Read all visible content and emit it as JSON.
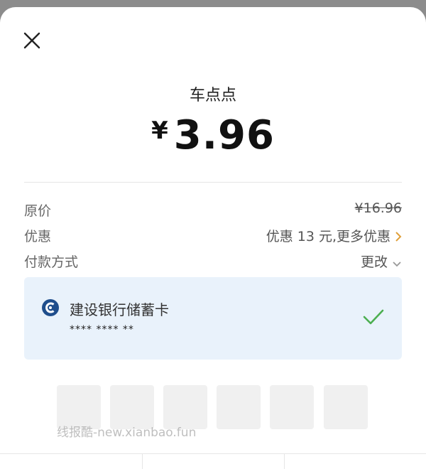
{
  "header": {
    "close_icon": "close-icon",
    "merchant": "车点点",
    "currency": "¥",
    "amount": "3.96"
  },
  "details": {
    "original": {
      "label": "原价",
      "value": "¥16.96"
    },
    "discount": {
      "label": "优惠",
      "value": "优惠 13 元,更多优惠"
    },
    "payment": {
      "label": "付款方式",
      "value": "更改"
    }
  },
  "card": {
    "bank_name": "建设银行储蓄卡",
    "number": "**** **** **",
    "selected": true
  },
  "pin": {
    "digits_entered": 0,
    "total_digits": 6
  },
  "watermark": "线报酷-new.xianbao.fun",
  "colors": {
    "accent_orange": "#e0a03a",
    "check_green": "#4caf50",
    "card_bg": "#e9f2fb",
    "bank_blue": "#1f4e8c"
  }
}
